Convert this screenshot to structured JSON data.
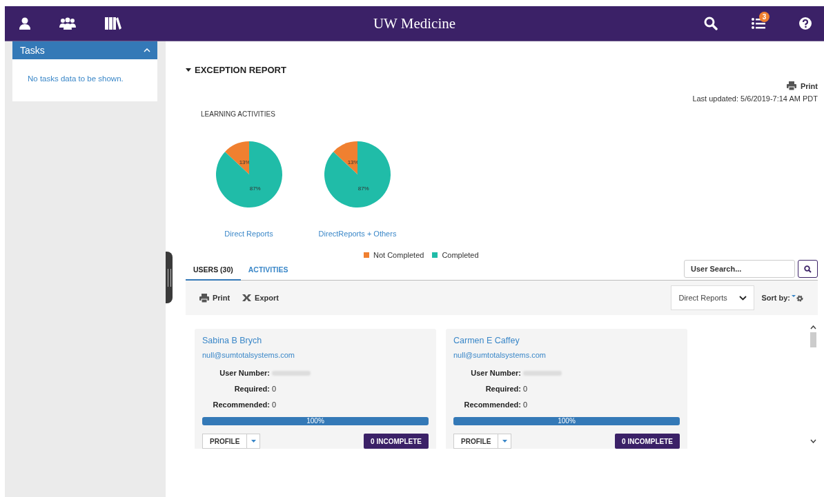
{
  "top_bar": {
    "title": "UW Medicine",
    "notification_count": "3"
  },
  "sidebar": {
    "panel": {
      "title": "Tasks",
      "expanded": true,
      "message": "No tasks data to be shown."
    }
  },
  "report": {
    "title": "EXCEPTION REPORT",
    "expanded": true,
    "print": "Print",
    "last_updated": "Last updated: 5/6/2019-7:14 AM PDT",
    "section_label": "LEARNING ACTIVITIES",
    "charts": [
      {
        "chart_data": {
          "type": "pie",
          "title": "Direct Reports",
          "values": [
            13,
            87
          ],
          "colors": [
            "#f08030",
            "#20bca8"
          ],
          "value_labels": [
            "13%",
            "87%"
          ]
        }
      },
      {
        "chart_data": {
          "type": "pie",
          "title": "DirectReports + Others",
          "values": [
            13,
            87
          ],
          "colors": [
            "#f08030",
            "#20bca8"
          ],
          "value_labels": [
            "13%",
            "87%"
          ]
        }
      }
    ],
    "legend": [
      {
        "label": "Not Completed",
        "color": "#f08030"
      },
      {
        "label": "Completed",
        "color": "#20bca8"
      }
    ]
  },
  "tabs": [
    {
      "label": "USERS (30)",
      "selected": true
    },
    {
      "label": "ACTIVITIES",
      "selected": false
    }
  ],
  "search": {
    "placeholder": "User Search..."
  },
  "toolbar": {
    "print": "Print",
    "export": "Export",
    "filter": "Direct Reports",
    "sort_label": "Sort by:"
  },
  "users": [
    {
      "name": "Sabina B Brych",
      "email": "null@sumtotalsystems.com",
      "fields": [
        {
          "label": "User Number:",
          "kind": "hidden"
        },
        {
          "label": "Required:",
          "value": "0",
          "kind": "text"
        },
        {
          "label": "Recommended:",
          "value": "0",
          "kind": "text"
        }
      ],
      "level": 1,
      "progress": "100%",
      "profile": "PROFILE",
      "incomplete": "0 INCOMPLETE"
    },
    {
      "name": "Carmen E Caffey",
      "email": "null@sumtotalsystems.com",
      "fields": [
        {
          "label": "User Number:",
          "kind": "hidden"
        },
        {
          "label": "Required:",
          "value": "0",
          "kind": "text"
        },
        {
          "label": "Recommended:",
          "value": "0",
          "kind": "text"
        }
      ],
      "level": 1,
      "progress": "100%",
      "profile": "PROFILE",
      "incomplete": "0 INCOMPLETE"
    }
  ]
}
